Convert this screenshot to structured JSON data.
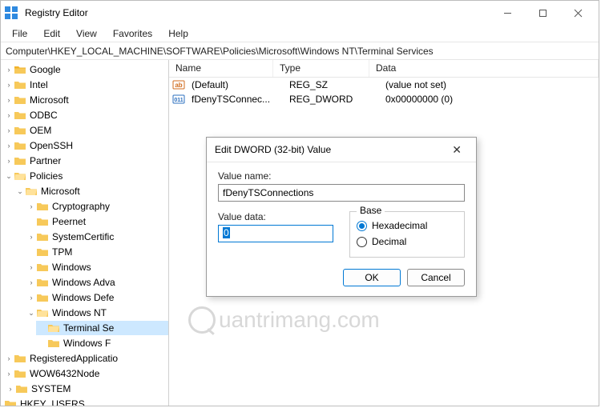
{
  "titlebar": {
    "title": "Registry Editor"
  },
  "menubar": {
    "file": "File",
    "edit": "Edit",
    "view": "View",
    "favorites": "Favorites",
    "help": "Help"
  },
  "path": "Computer\\HKEY_LOCAL_MACHINE\\SOFTWARE\\Policies\\Microsoft\\Windows NT\\Terminal Services",
  "tree": {
    "google": "Google",
    "intel": "Intel",
    "microsoft": "Microsoft",
    "odbc": "ODBC",
    "oem": "OEM",
    "openssh": "OpenSSH",
    "partner": "Partner",
    "policies": "Policies",
    "policies_microsoft": "Microsoft",
    "cryptography": "Cryptography",
    "peernet": "Peernet",
    "systemcert": "SystemCertific",
    "tpm": "TPM",
    "windows": "Windows",
    "windowsadv": "Windows Adva",
    "windowsdef": "Windows Defe",
    "windowsnt": "Windows NT",
    "terminal": "Terminal Se",
    "windowsf": "Windows F",
    "regapp": "RegisteredApplicatio",
    "wow64": "WOW6432Node",
    "system": "SYSTEM",
    "hkeyusers": "HKEY_USERS"
  },
  "list": {
    "headers": {
      "name": "Name",
      "type": "Type",
      "data": "Data"
    },
    "rows": [
      {
        "icon": "string",
        "name": "(Default)",
        "type": "REG_SZ",
        "data": "(value not set)"
      },
      {
        "icon": "dword",
        "name": "fDenyTSConnec...",
        "type": "REG_DWORD",
        "data": "0x00000000 (0)"
      }
    ]
  },
  "dialog": {
    "title": "Edit DWORD (32-bit) Value",
    "value_name_label": "Value name:",
    "value_name": "fDenyTSConnections",
    "value_data_label": "Value data:",
    "value_data": "0",
    "base_legend": "Base",
    "hex": "Hexadecimal",
    "dec": "Decimal",
    "ok": "OK",
    "cancel": "Cancel"
  },
  "watermark": "uantrimang.com"
}
